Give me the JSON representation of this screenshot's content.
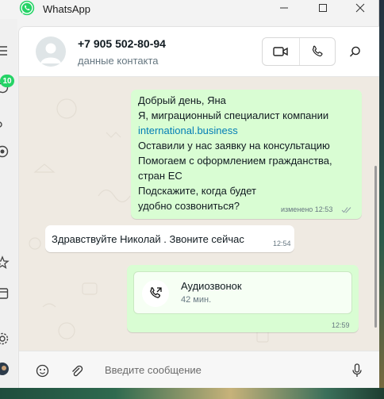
{
  "window": {
    "title": "WhatsApp",
    "controls": [
      "minimize",
      "maximize",
      "close"
    ]
  },
  "nav": {
    "icons": [
      "menu-icon",
      "chats-icon",
      "calls-icon",
      "status-icon",
      "starred-icon",
      "archive-icon",
      "settings-icon",
      "profile-icon"
    ],
    "unread_badge": "10"
  },
  "header": {
    "contact_name": "+7 905 502-80-94",
    "contact_subtitle": "данные контакта",
    "actions": [
      "video-call-icon",
      "voice-call-icon",
      "search-icon"
    ]
  },
  "messages": [
    {
      "direction": "outgoing",
      "lines": [
        "Добрый день, Яна",
        "Я, миграционный специалист компании",
        "international.business",
        "Оставили у нас заявку на консультацию",
        "Помогаем с оформлением гражданства,",
        "стран ЕС",
        "Подскажите, когда будет",
        "удобно созвониться?"
      ],
      "edited_time": "изменено 12:53",
      "status": "read"
    },
    {
      "direction": "incoming",
      "text": "Здравствуйте Николай . Звоните сейчас",
      "time": "12:54"
    },
    {
      "direction": "outgoing",
      "type": "call",
      "call_title": "Аудиозвонок",
      "call_duration": "42 мин.",
      "time": "12:59"
    }
  ],
  "composer": {
    "placeholder": "Введите сообщение",
    "icons": [
      "emoji-icon",
      "attach-icon",
      "mic-icon"
    ]
  },
  "colors": {
    "brand": "#25d366",
    "outgoing_bubble": "#d9fdd3",
    "incoming_bubble": "#ffffff",
    "chat_background": "#efeae2",
    "link": "#027eb5"
  }
}
